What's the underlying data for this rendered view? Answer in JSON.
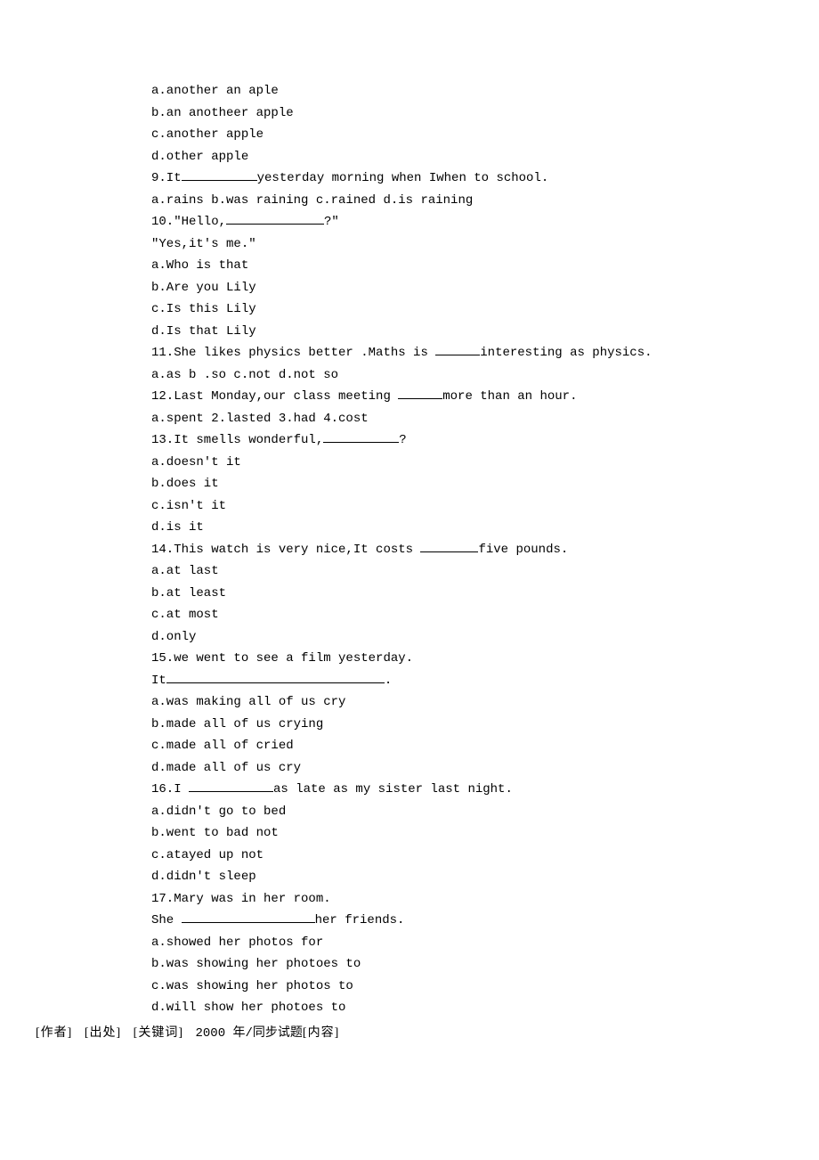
{
  "lines": {
    "l01": "a.another an aple",
    "l02": "b.an anotheer apple",
    "l03": "c.another apple",
    "l04": "d.other apple",
    "l05a": "9.It",
    "l05b": "yesterday morning when Iwhen to school.",
    "l06": "a.rains b.was raining c.rained d.is raining",
    "l07a": "10.\"Hello,",
    "l07b": "?\"",
    "l08": "\"Yes,it's me.\"",
    "l09": "a.Who is that",
    "l10": "b.Are you Lily",
    "l11": "c.Is this Lily",
    "l12": "d.Is that Lily",
    "l13a": "11.She likes physics better .Maths is ",
    "l13b": "interesting as physics.",
    "l14": "a.as b .so c.not d.not so",
    "l15a": "12.Last Monday,our class meeting ",
    "l15b": "more than an hour.",
    "l16": "a.spent 2.lasted 3.had 4.cost",
    "l17a": "13.It smells wonderful,",
    "l17b": "?",
    "l18": "a.doesn't it",
    "l19": "b.does it",
    "l20": "c.isn't it",
    "l21": "d.is it",
    "l22a": "14.This watch is very nice,It costs ",
    "l22b": "five pounds.",
    "l23": "a.at last",
    "l24": "b.at least",
    "l25": "c.at most",
    "l26": "d.only",
    "l27": "15.we went to see a film yesterday.",
    "l28a": "It",
    "l28b": ".",
    "l29": "a.was making all of us cry",
    "l30": "b.made all of us crying",
    "l31": "c.made all of cried",
    "l32": "d.made all of us cry",
    "l33a": "16.I ",
    "l33b": "as late as my sister last night.",
    "l34": "a.didn't go to bed",
    "l35": "b.went to bad not",
    "l36": "c.atayed up not",
    "l37": "d.didn't sleep",
    "l38": "17.Mary was in her room.",
    "l39a": "She ",
    "l39b": "her friends.",
    "l40": "a.showed her photos for",
    "l41": "b.was showing her photoes to",
    "l42": "c.was showing her photos to",
    "l43": "d.will show her photoes to"
  },
  "meta": {
    "author_label": "[作者]",
    "source_label": "[出处]",
    "keyword_label": "[关键词]",
    "keyword_value": "2000 年/同步试题",
    "content_label": "[内容]"
  }
}
